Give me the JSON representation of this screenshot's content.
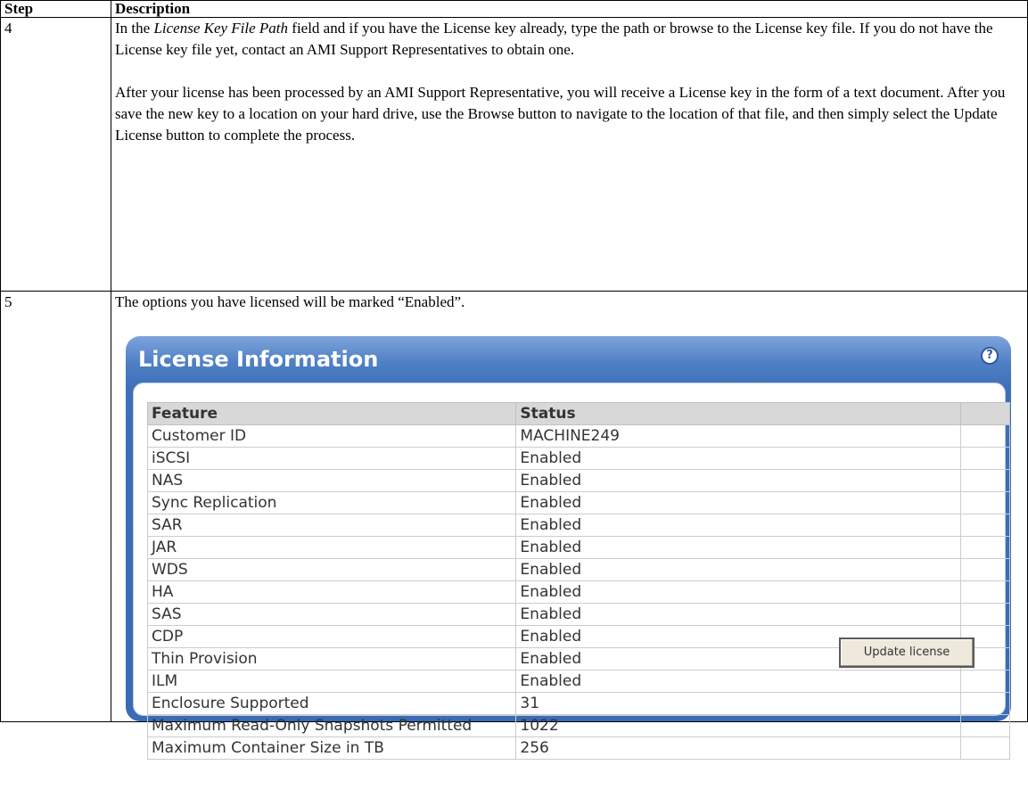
{
  "table": {
    "headers": {
      "step": "Step",
      "description": "Description"
    },
    "rows": [
      {
        "step": "4",
        "p1_before": "In the ",
        "p1_italic": "License Key File Path",
        "p1_after": " field and if you have the License key already, type the path or browse to the License key file. If you do not have the License key file yet, contact an AMI Support Representatives to obtain one.",
        "p2": "After your license has been processed by an AMI Support Representative, you will receive a License key in the form of a text document. After you save the new key to a location on your hard drive, use the Browse button to navigate to the location of that file, and then simply select the Update License button to complete the process."
      },
      {
        "step": "5",
        "p1": "The options you have licensed will be marked “Enabled”."
      }
    ]
  },
  "license_panel": {
    "title": "License Information",
    "help_icon": "help-question-icon",
    "columns": [
      "Feature",
      "Status",
      ""
    ],
    "rows": [
      {
        "feature": "Customer ID",
        "status": "MACHINE249"
      },
      {
        "feature": "iSCSI",
        "status": "Enabled"
      },
      {
        "feature": "NAS",
        "status": "Enabled"
      },
      {
        "feature": "Sync Replication",
        "status": "Enabled"
      },
      {
        "feature": "SAR",
        "status": "Enabled"
      },
      {
        "feature": "JAR",
        "status": "Enabled"
      },
      {
        "feature": "WDS",
        "status": "Enabled"
      },
      {
        "feature": "HA",
        "status": "Enabled"
      },
      {
        "feature": "SAS",
        "status": "Enabled"
      },
      {
        "feature": "CDP",
        "status": "Enabled"
      },
      {
        "feature": "Thin Provision",
        "status": "Enabled"
      },
      {
        "feature": "ILM",
        "status": "Enabled"
      },
      {
        "feature": "Enclosure Supported",
        "status": "31"
      },
      {
        "feature": "Maximum Read-Only Snapshots Permitted",
        "status": "1022"
      },
      {
        "feature": "Maximum Container Size in TB",
        "status": "256"
      }
    ],
    "update_button": "Update license"
  },
  "colors": {
    "panel_blue": "#3e6fb8",
    "header_gray": "#d8d8d8",
    "button_bg": "#efe9dc"
  }
}
